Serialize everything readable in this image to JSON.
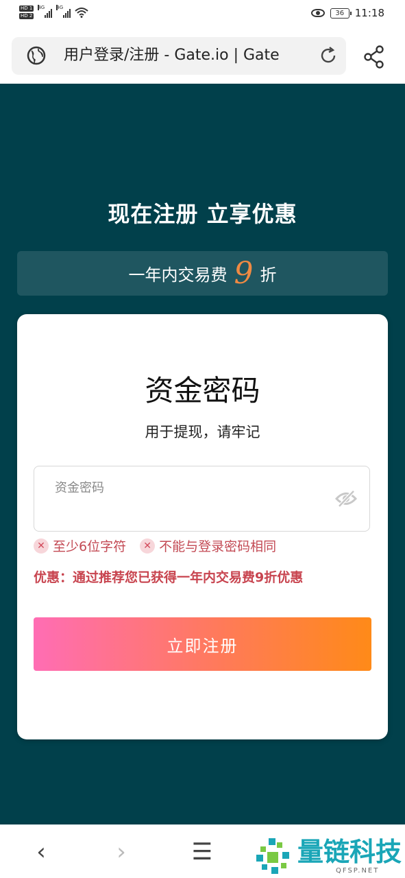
{
  "status_bar": {
    "sim1": "HD 1",
    "sim2": "HD 2",
    "net1": "4G",
    "net2": "4G",
    "battery": "36",
    "time": "11:18"
  },
  "browser": {
    "url_title": "用户登录/注册 - Gate.io | Gate"
  },
  "page": {
    "headline": "现在注册 立享优惠",
    "promo_text": "一年内交易费",
    "promo_number": "9",
    "promo_suffix": "折",
    "accent_color": "#f08a43",
    "background_color": "#01404b"
  },
  "form": {
    "title": "资金密码",
    "subtitle": "用于提现，请牢记",
    "field_label": "资金密码",
    "field_value": "",
    "rules": [
      "至少6位字符",
      "不能与登录密码相同"
    ],
    "offer": "优惠：通过推荐您已获得一年内交易费9折优惠",
    "submit_label": "立即注册"
  },
  "nav": {
    "back": "‹",
    "forward": "›",
    "menu": "☰"
  },
  "watermark": {
    "text": "量链科技",
    "sub": "QFSP.NET"
  }
}
